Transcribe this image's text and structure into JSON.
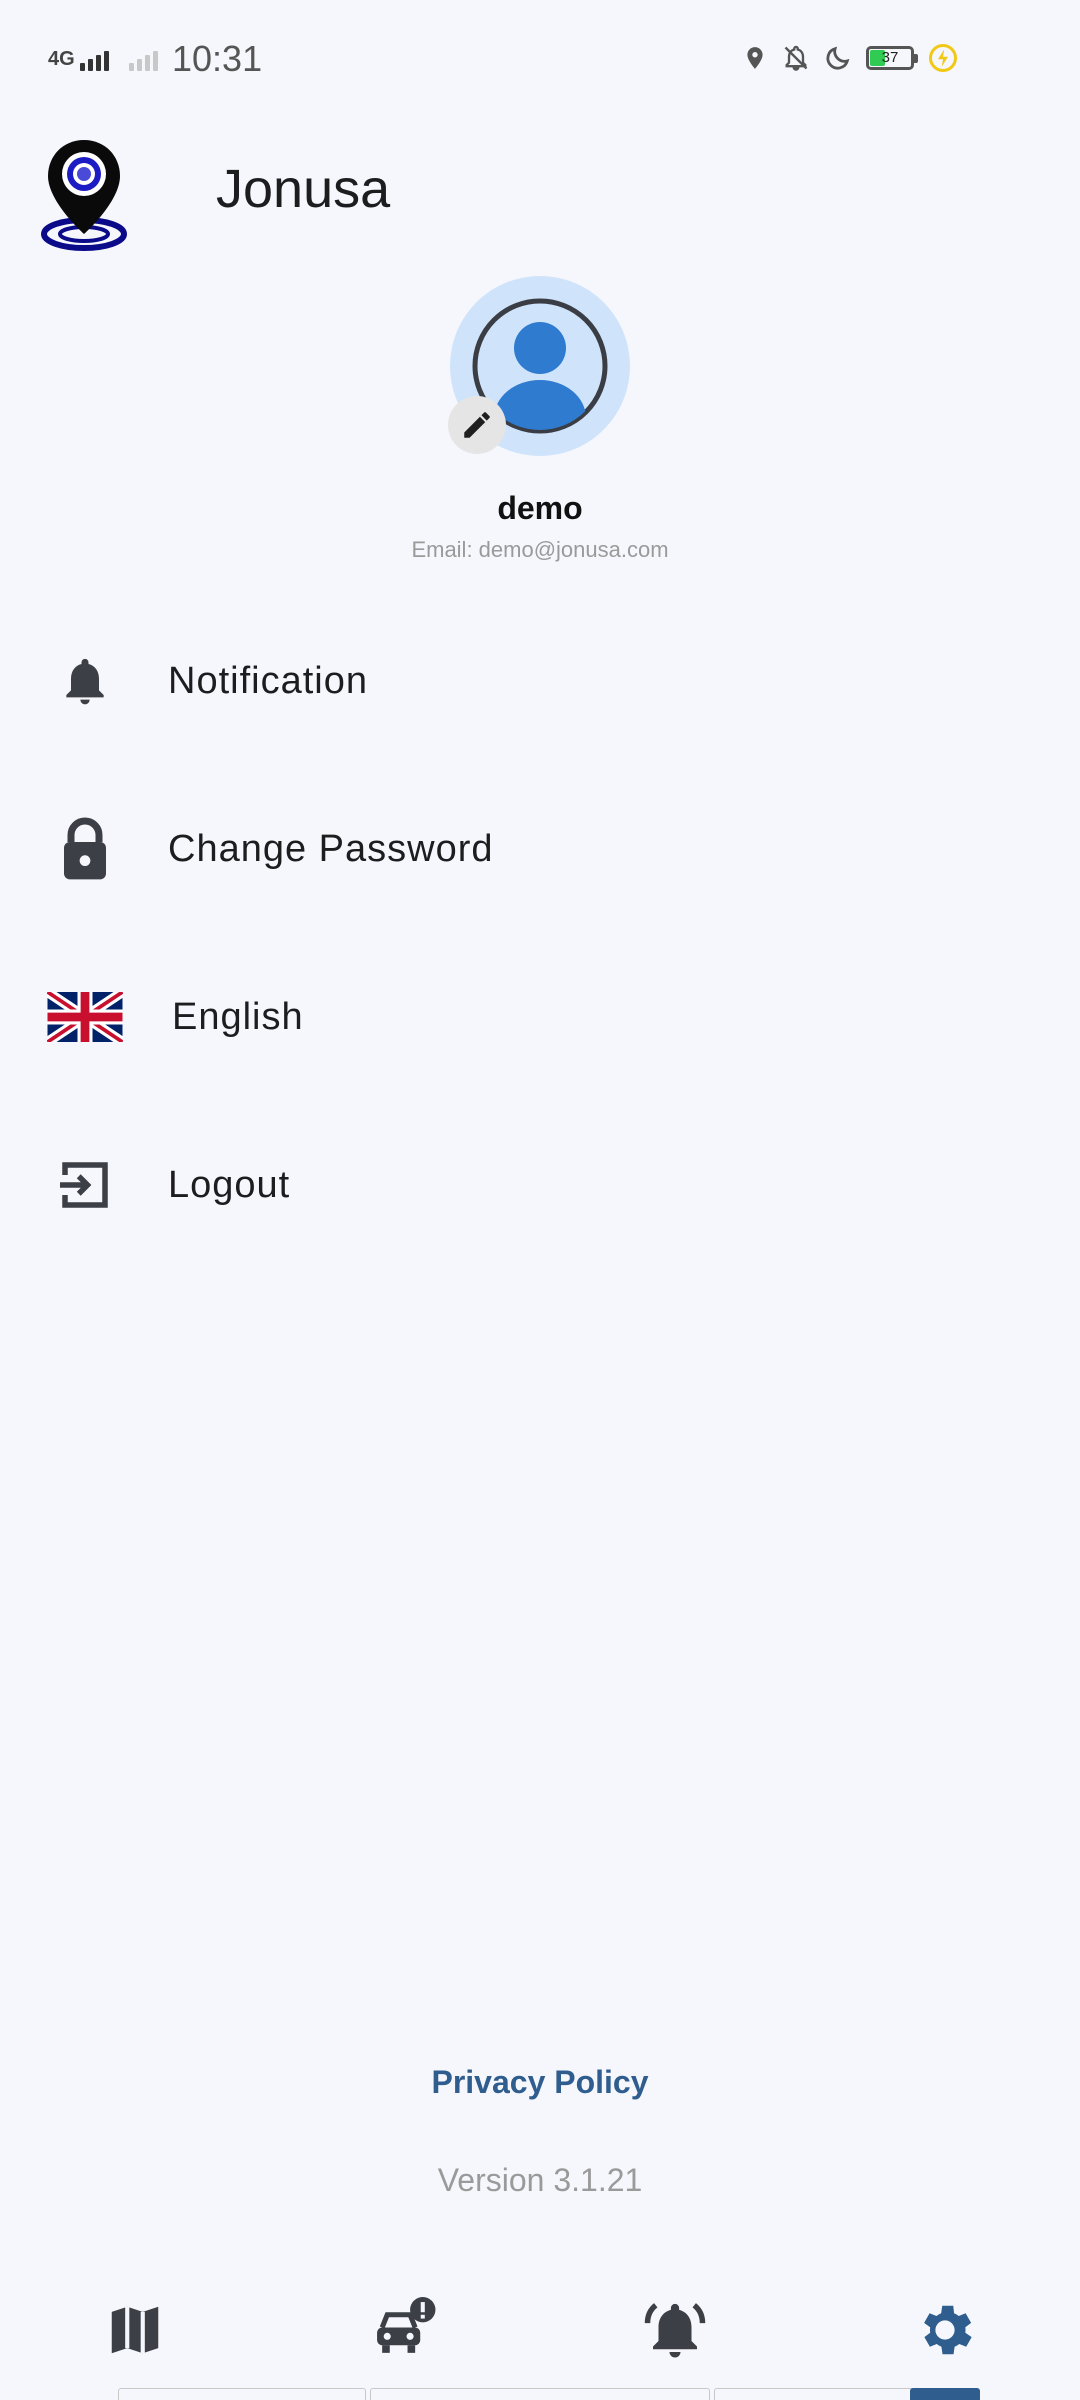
{
  "status_bar": {
    "network_type": "4G",
    "time": "10:31",
    "battery_level": "37",
    "icons": [
      "location-icon",
      "bell-off-icon",
      "moon-icon",
      "battery-icon",
      "charging-icon"
    ]
  },
  "header": {
    "app_title": "Jonusa",
    "logo": "map-pin-logo"
  },
  "profile": {
    "name": "demo",
    "email": "Email: demo@jonusa.com",
    "avatar_bg": "#cfe3fb",
    "avatar_accent": "#2f7bd0"
  },
  "menu": {
    "items": [
      {
        "label": "Notification",
        "icon": "bell-icon"
      },
      {
        "label": "Change Password",
        "icon": "lock-icon"
      },
      {
        "label": "English",
        "icon": "uk-flag-icon"
      },
      {
        "label": "Logout",
        "icon": "logout-icon"
      }
    ]
  },
  "footer": {
    "privacy_policy": "Privacy Policy",
    "version": "Version 3.1.21"
  },
  "bottom_nav": {
    "tabs": [
      {
        "name": "map",
        "icon": "map-icon"
      },
      {
        "name": "vehicle-alerts",
        "icon": "car-alert-icon"
      },
      {
        "name": "alarms",
        "icon": "alarm-bell-icon"
      },
      {
        "name": "settings",
        "icon": "gear-icon",
        "active": true
      }
    ],
    "active_color": "#2f5e8e",
    "inactive_color": "#3c3f46"
  }
}
